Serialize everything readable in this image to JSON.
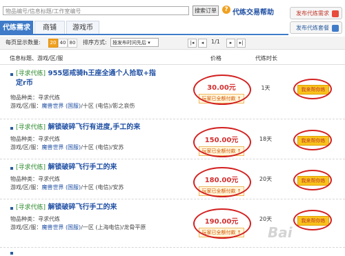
{
  "search": {
    "placeholder": "物品编号/信息标题/工作室编号",
    "button": "搜索订单"
  },
  "help_link": "代练交易帮助",
  "publish": {
    "demand": "发布代练需求",
    "package": "发布代练套餐"
  },
  "tabs": [
    "代练需求",
    "商铺",
    "游戏币"
  ],
  "pager": {
    "per_page_label": "每页显示数量:",
    "sizes": [
      "20",
      "40",
      "80"
    ],
    "sort_label": "排序方式:",
    "sort_value": "按发布时间先后",
    "page": "1/1"
  },
  "columns": {
    "title": "信息标题、游戏/区/服",
    "price": "价格",
    "duration": "代练时长"
  },
  "rows": [
    {
      "tag": "[寻求代练]",
      "title": "955惩戒骑h王座全通个人拾取+指定r币",
      "type": "物品种类：寻求代练",
      "server_prefix": "游戏/区/服：",
      "game": "魔兽世界",
      "region": "(国服)",
      "server": "/十区 (电信)/影之哀伤",
      "price": "30.00元",
      "guarantee": "玩家已全额付款",
      "duration": "1天",
      "help": "我来帮你练"
    },
    {
      "tag": "[寻求代练]",
      "title": "解锁破碎飞行有进度,手工的来",
      "type": "物品种类：寻求代练",
      "server_prefix": "游戏/区/服：",
      "game": "魔兽世界",
      "region": "(国服)",
      "server": "/十区 (电信)/安苏",
      "price": "150.00元",
      "guarantee": "玩家已全额付款",
      "duration": "18天",
      "help": "我来帮你练"
    },
    {
      "tag": "[寻求代练]",
      "title": "解锁破碎飞行手工的来",
      "type": "物品种类：寻求代练",
      "server_prefix": "游戏/区/服：",
      "game": "魔兽世界",
      "region": "(国服)",
      "server": "/十区 (电信)/安苏",
      "price": "180.00元",
      "guarantee": "玩家已全额付款",
      "duration": "20天",
      "help": "我来帮你练"
    },
    {
      "tag": "[寻求代练]",
      "title": "解锁破碎飞行手工的来",
      "type": "物品种类：寻求代练",
      "server_prefix": "游戏/区/服：",
      "game": "魔兽世界",
      "region": "(国服)",
      "server": "/一区 (上海电信)/龙骨平原",
      "price": "190.00元",
      "guarantee": "玩家已全额付款",
      "duration": "20天",
      "help": "我来帮你练"
    }
  ],
  "watermark": "Bai"
}
